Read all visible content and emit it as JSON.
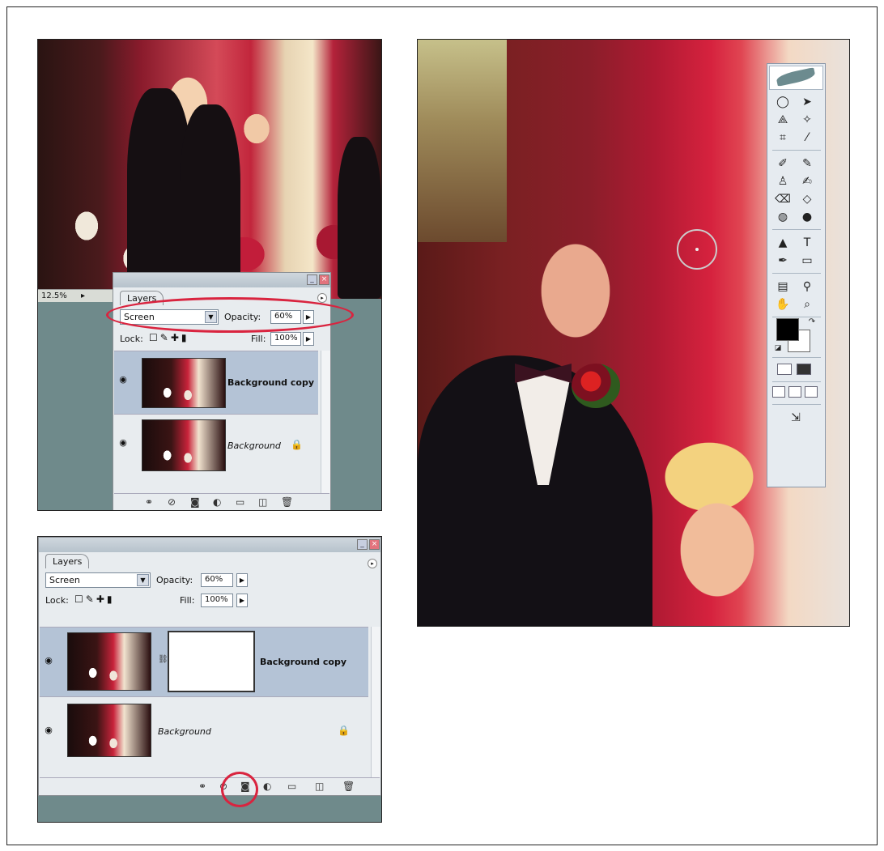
{
  "top_palette": {
    "tab": "Layers",
    "blend_mode": "Screen",
    "opacity_label": "Opacity:",
    "opacity_value": "60%",
    "lock_label": "Lock:",
    "fill_label": "Fill:",
    "fill_value": "100%",
    "layers": [
      {
        "name": "Background copy",
        "style": "bold",
        "active": true
      },
      {
        "name": "Background",
        "style": "italic",
        "locked": true
      }
    ],
    "zoom": "12.5%"
  },
  "bottom_palette": {
    "tab": "Layers",
    "blend_mode": "Screen",
    "opacity_label": "Opacity:",
    "opacity_value": "60%",
    "lock_label": "Lock:",
    "fill_label": "Fill:",
    "fill_value": "100%",
    "layers": [
      {
        "name": "Background copy",
        "style": "bold",
        "active": true,
        "has_mask": true
      },
      {
        "name": "Background",
        "style": "italic",
        "locked": true
      }
    ]
  },
  "bottom_bar_icons": [
    "link-icon",
    "layer-style-icon",
    "add-mask-icon",
    "adjustment-layer-icon",
    "new-group-icon",
    "new-layer-icon",
    "trash-icon"
  ],
  "toolbox": {
    "tools": [
      "elliptical-marquee-tool",
      "move-tool",
      "polygonal-lasso-tool",
      "magic-wand-tool",
      "crop-tool",
      "slice-tool",
      "healing-brush-tool",
      "brush-tool",
      "clone-stamp-tool",
      "history-brush-tool",
      "eraser-tool",
      "paint-bucket-tool",
      "blur-tool",
      "dodge-tool",
      "path-selection-tool",
      "type-tool",
      "pen-tool",
      "rectangle-tool",
      "notes-tool",
      "eyedropper-tool",
      "hand-tool",
      "zoom-tool"
    ],
    "foreground_color": "#000000",
    "background_color": "#ffffff"
  },
  "highlight_color": "#d9243f"
}
